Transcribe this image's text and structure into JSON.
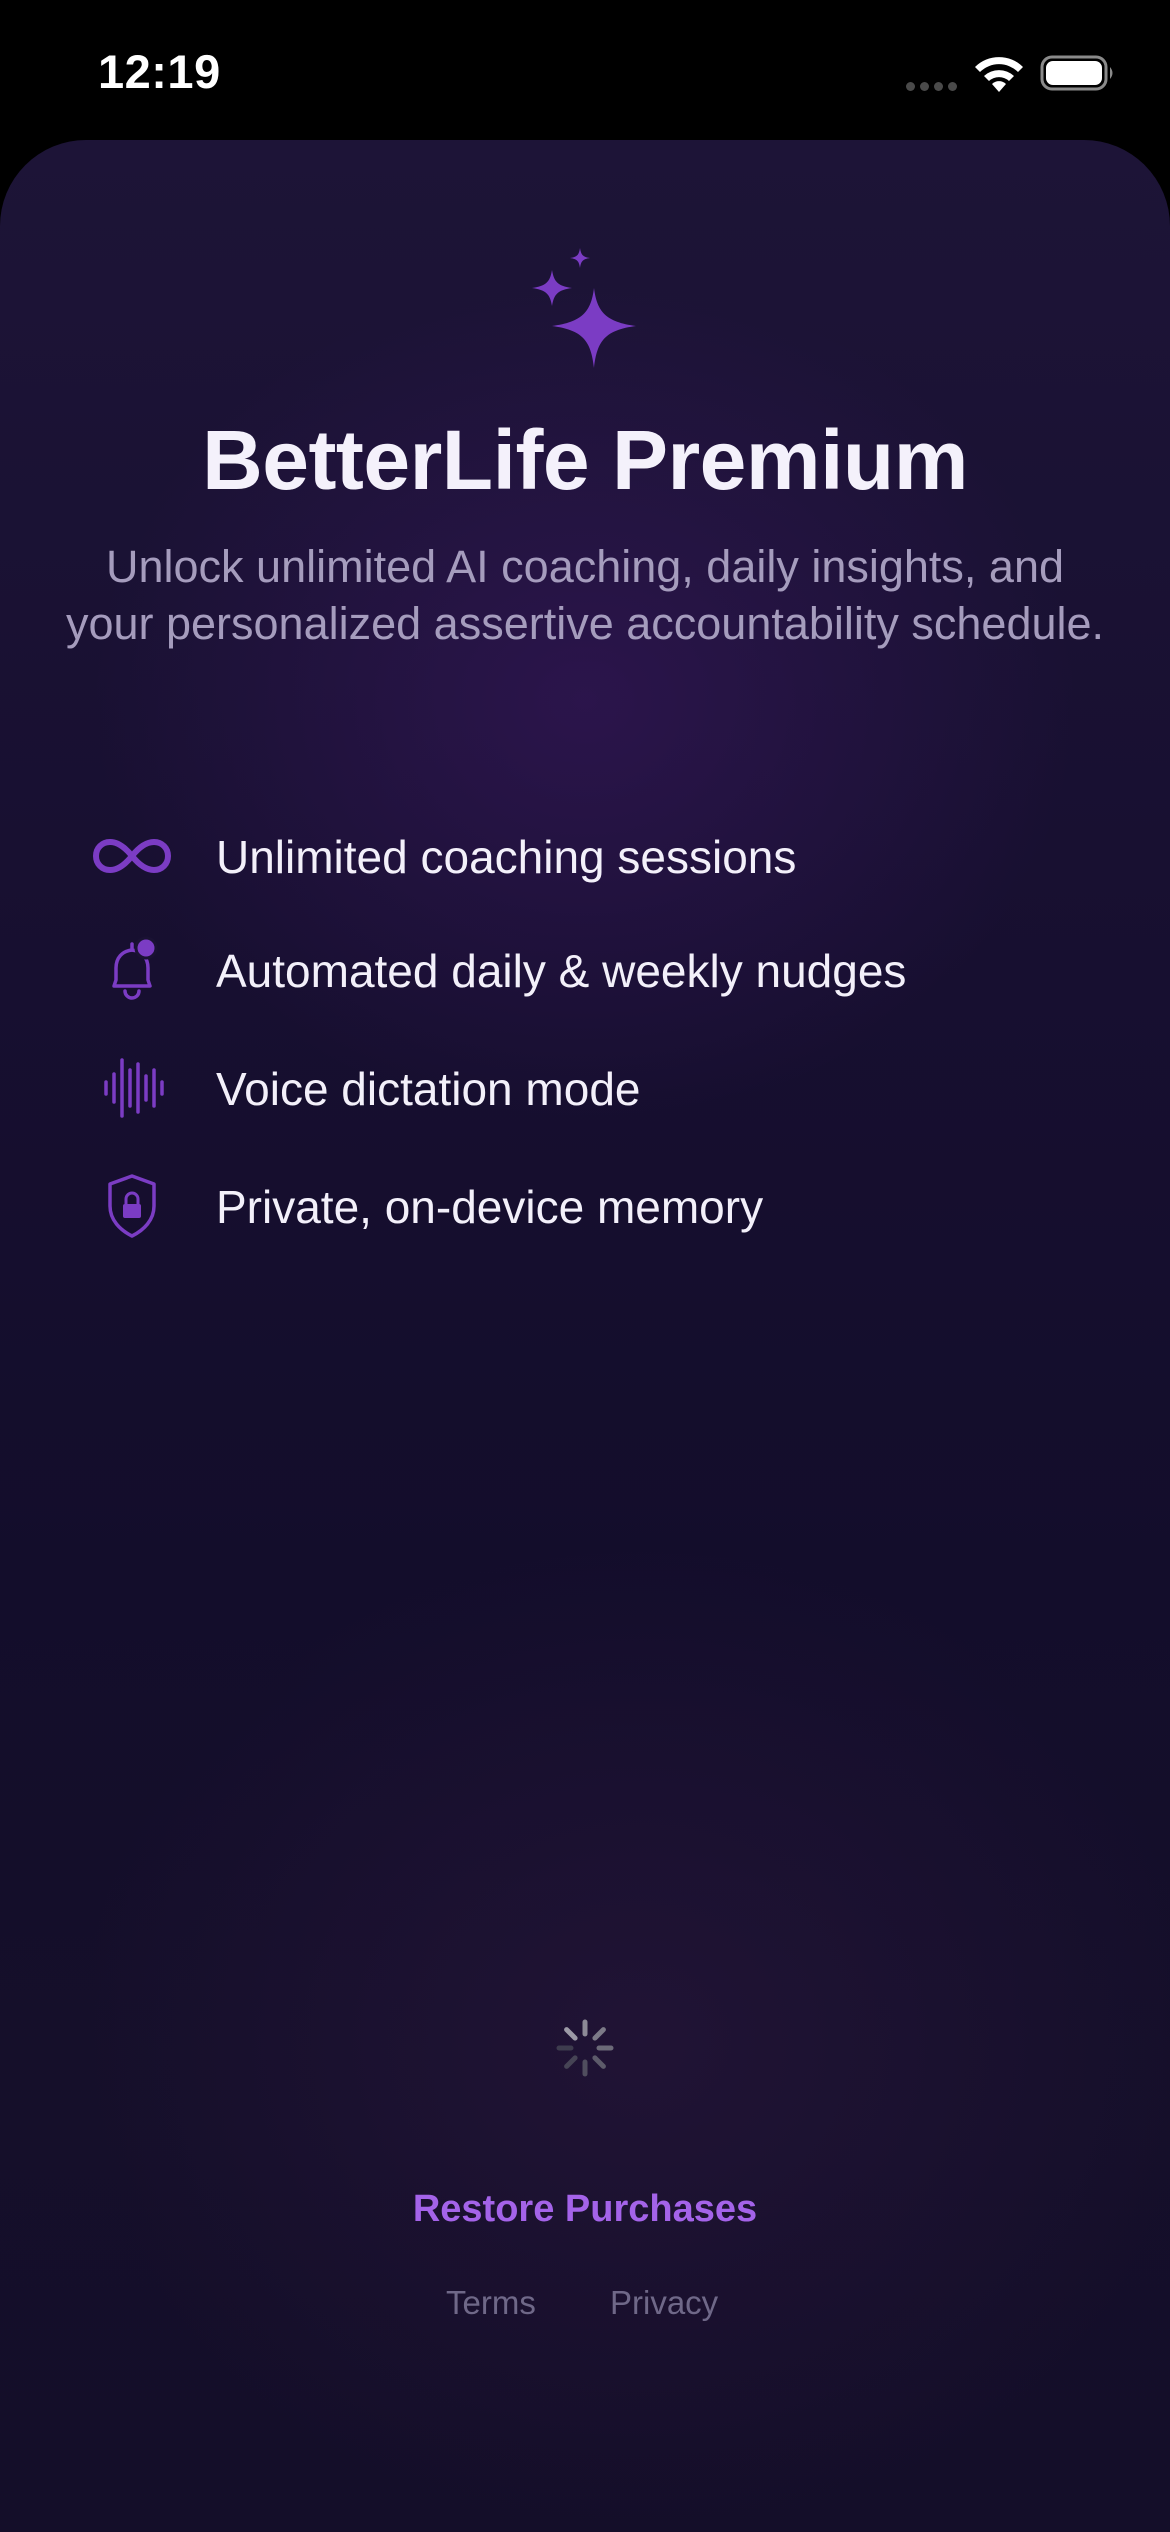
{
  "status_bar": {
    "time": "12:19"
  },
  "paywall": {
    "icon": "sparkles-icon",
    "title": "BetterLife Premium",
    "subtitle": "Unlock unlimited AI coaching, daily insights, and your personalized assertive accountability schedule.",
    "features": [
      {
        "icon": "infinity-icon",
        "label": "Unlimited coaching sessions"
      },
      {
        "icon": "bell-badge-icon",
        "label": "Automated daily & weekly nudges"
      },
      {
        "icon": "waveform-icon",
        "label": "Voice dictation mode"
      },
      {
        "icon": "lock-shield-icon",
        "label": "Private, on-device memory"
      }
    ],
    "loading_state": "spinner-icon",
    "restore_label": "Restore Purchases",
    "terms_label": "Terms",
    "privacy_label": "Privacy"
  },
  "colors": {
    "accent": "#7b3cc4",
    "restore_link": "#a463e9",
    "background_top": "#1d1437",
    "background_bottom": "#140e29",
    "subtitle_text": "#a59cbd",
    "footer_link": "#6f6888"
  }
}
